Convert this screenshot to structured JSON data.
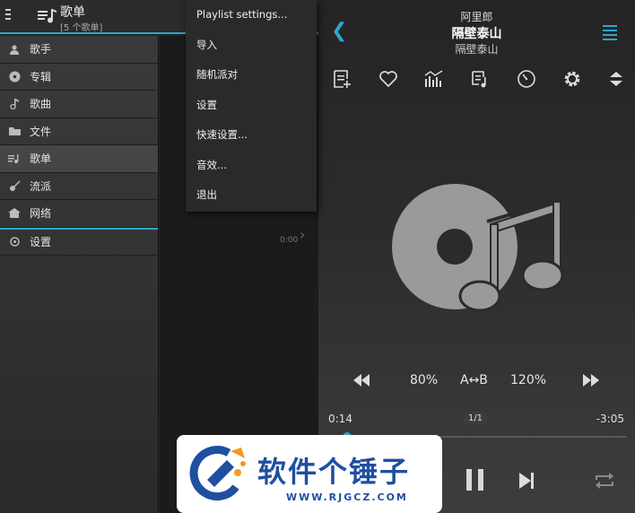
{
  "header": {
    "title": "歌单",
    "subtitle": "[5 个歌单]"
  },
  "nav": {
    "items": [
      {
        "label": "歌手",
        "icon": "person-icon"
      },
      {
        "label": "专辑",
        "icon": "disc-icon"
      },
      {
        "label": "歌曲",
        "icon": "music-note-icon"
      },
      {
        "label": "文件",
        "icon": "folder-icon"
      },
      {
        "label": "歌单",
        "icon": "playlist-icon"
      },
      {
        "label": "流派",
        "icon": "guitar-icon"
      },
      {
        "label": "网络",
        "icon": "network-icon"
      }
    ],
    "active_index": 4,
    "settings_label": "设置"
  },
  "list": {
    "time": "0:00"
  },
  "dropdown": {
    "items": [
      "Playlist settings...",
      "导入",
      "随机派对",
      "设置",
      "快速设置...",
      "音效...",
      "退出"
    ]
  },
  "player": {
    "artist": "阿里郎",
    "song": "隔壁泰山",
    "album": "隔壁泰山",
    "speed_down": "80%",
    "ab_repeat": "A↔B",
    "speed_up": "120%",
    "position": "0:14",
    "remaining": "-3:05",
    "track_counter": "1/1",
    "progress_fraction": 0.07
  },
  "colors": {
    "accent": "#2fa6c8"
  },
  "watermark": {
    "name": "软件个锤子",
    "url": "WWW.RJGCZ.COM"
  }
}
